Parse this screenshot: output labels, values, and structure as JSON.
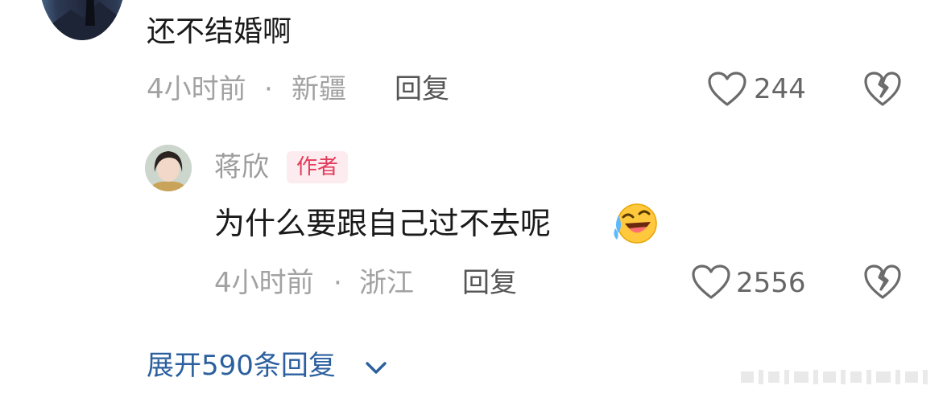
{
  "comment": {
    "text": "还不结婚啊",
    "time": "4小时前",
    "separator": "·",
    "location": "新疆",
    "reply_label": "回复",
    "like_count": "244"
  },
  "reply": {
    "author": "蒋欣",
    "badge": "作者",
    "text": "为什么要跟自己过不去呢",
    "emoji": "laughing-crying-emoji",
    "time": "4小时前",
    "separator": "·",
    "location": "浙江",
    "reply_label": "回复",
    "like_count": "2556"
  },
  "expand": {
    "label": "展开590条回复"
  },
  "icons": {
    "like": "heart-outline-icon",
    "dislike": "broken-heart-icon",
    "expand": "chevron-down-icon"
  },
  "colors": {
    "link": "#2b5f9e",
    "badge_text": "#e43a5b",
    "badge_bg": "#fdecef",
    "meta_text": "#a2a2a2"
  }
}
